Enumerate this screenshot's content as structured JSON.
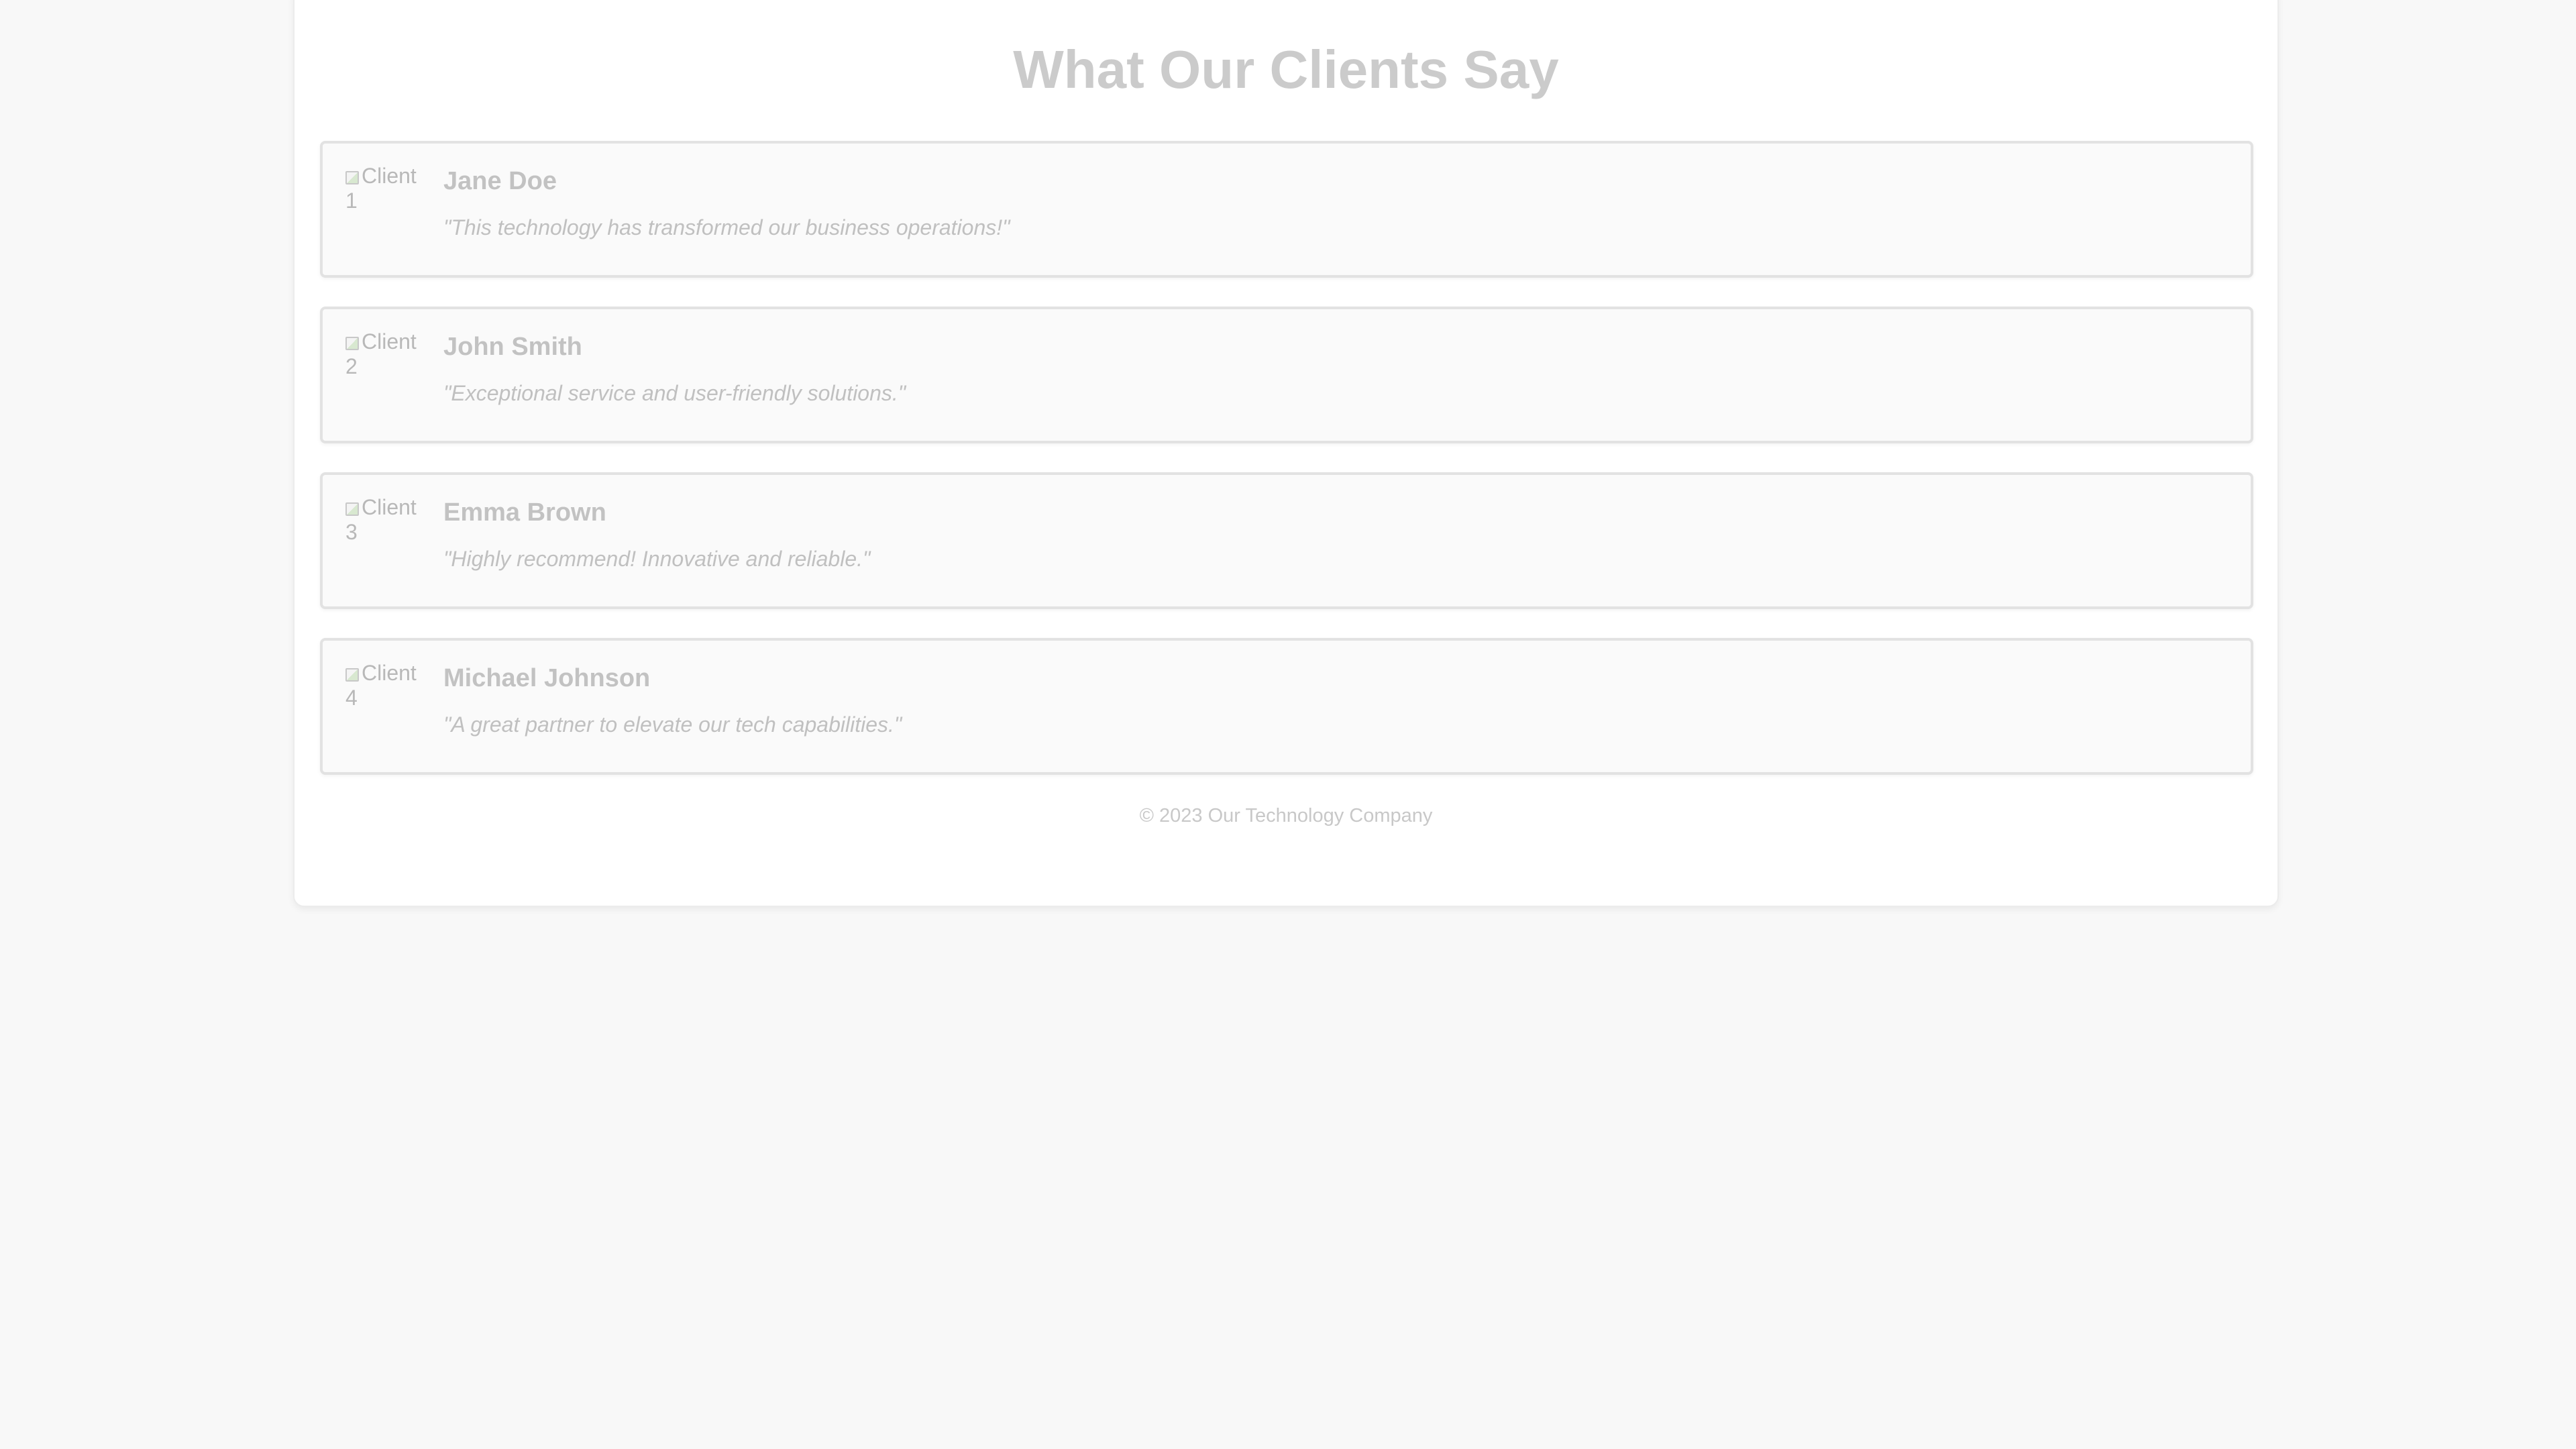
{
  "page": {
    "title": "What Our Clients Say"
  },
  "testimonials": [
    {
      "avatar_alt": "Client 1",
      "name": "Jane Doe",
      "quote": "\"This technology has transformed our business operations!\""
    },
    {
      "avatar_alt": "Client 2",
      "name": "John Smith",
      "quote": "\"Exceptional service and user-friendly solutions.\""
    },
    {
      "avatar_alt": "Client 3",
      "name": "Emma Brown",
      "quote": "\"Highly recommend! Innovative and reliable.\""
    },
    {
      "avatar_alt": "Client 4",
      "name": "Michael Johnson",
      "quote": "\"A great partner to elevate our tech capabilities.\""
    }
  ],
  "footer": {
    "text": "© 2023 Our Technology Company"
  },
  "icons": {
    "avatar": "broken-image-icon"
  },
  "colors": {
    "background": "#f8f8f8",
    "container": "#ffffff",
    "card": "#fafafa",
    "card_border": "#e2e2e2",
    "title_text": "#cbcbcb",
    "body_text": "#c0c0c0"
  }
}
